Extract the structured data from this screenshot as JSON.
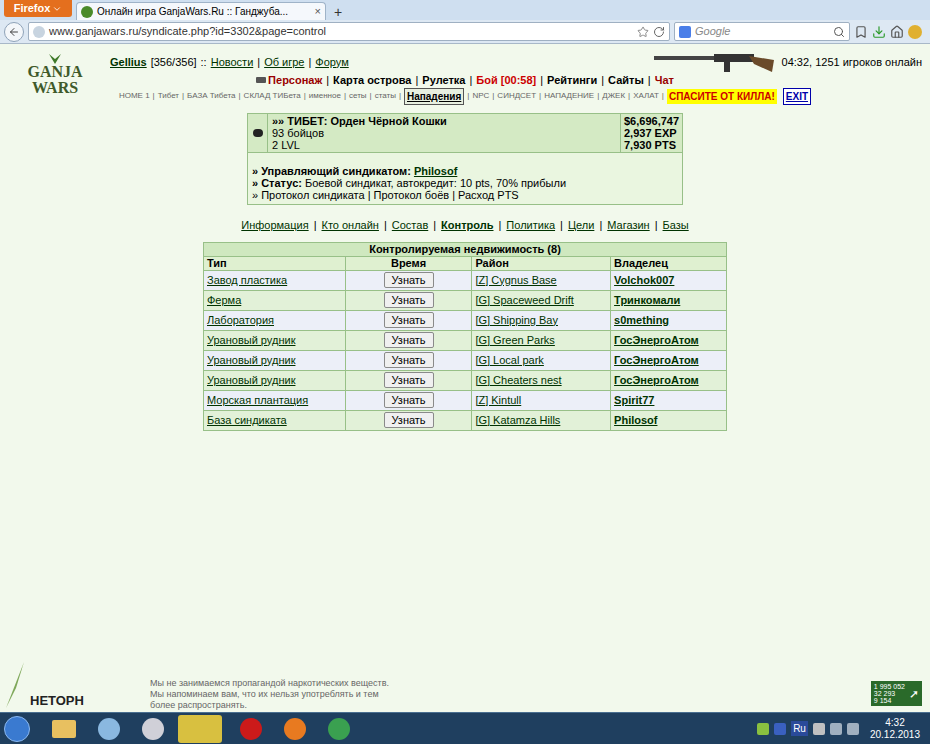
{
  "browser": {
    "menu_button": "Firefox",
    "tab": {
      "title": "Онлайн игра GanjaWars.Ru :: Ганджуба...",
      "close": "×"
    },
    "new_tab": "+",
    "url": "www.ganjawars.ru/syndicate.php?id=3302&page=control",
    "search_placeholder": "Google"
  },
  "header": {
    "logo": [
      "GANJA",
      "WARS"
    ],
    "user": "Gellius",
    "hp": "[356/356]",
    "separator": "::",
    "links": [
      "Новости",
      "Об игре",
      "Форум"
    ],
    "clock": "04:32, 1251 игроков онлайн"
  },
  "separator": "|",
  "main_menu": [
    {
      "label": "Персонаж",
      "color": "#990000"
    },
    {
      "label": "Карта острова",
      "color": "#000000"
    },
    {
      "label": "Рулетка",
      "color": "#000000"
    },
    {
      "label": "Бой [00:58]",
      "color": "#cc0000"
    },
    {
      "label": "Рейтинги",
      "color": "#000000"
    },
    {
      "label": "Сайты",
      "color": "#000000"
    },
    {
      "label": "Чат",
      "color": "#990000"
    }
  ],
  "quick_links": [
    {
      "label": "HOME 1",
      "kind": "link",
      "selected": false
    },
    {
      "label": "Тибет",
      "kind": "link",
      "selected": false
    },
    {
      "label": "БАЗА Тибета",
      "kind": "link",
      "selected": false
    },
    {
      "label": "СКЛАД ТИБета",
      "kind": "link",
      "selected": false
    },
    {
      "label": "именное",
      "kind": "link",
      "selected": false
    },
    {
      "label": "сеты",
      "kind": "link",
      "selected": false
    },
    {
      "label": "статы",
      "kind": "link",
      "selected": false
    },
    {
      "label": "Нападения",
      "kind": "link",
      "selected": true
    },
    {
      "label": "NPC",
      "kind": "link",
      "selected": false
    },
    {
      "label": "СИНДСЕТ",
      "kind": "link",
      "selected": false
    },
    {
      "label": "НАПАДЕНИЕ",
      "kind": "link",
      "selected": false
    },
    {
      "label": "ДЖЕК",
      "kind": "link",
      "selected": false
    },
    {
      "label": "ХАЛАТ",
      "kind": "link",
      "selected": false
    },
    {
      "label": "СПАСИТЕ ОТ КИЛЛА!",
      "kind": "alert",
      "selected": false
    },
    {
      "label": "EXIT",
      "kind": "exit",
      "selected": false
    }
  ],
  "syndicate": {
    "name": "»» ТИБЕТ: Орден Чёрной Кошки",
    "fighters": "93 бойцов",
    "level": "2 LVL",
    "money": "$6,696,747",
    "exp": "2,937 EXP",
    "pts": "7,930 PTS",
    "manager_label": "» Управляющий синдикатом:",
    "manager": "Philosof",
    "status_label": "» Статус:",
    "status": "Боевой синдикат, автокредит: 10 pts, 70% прибыли",
    "protocols_prefix": "»",
    "protocols": [
      "Протокол синдиката",
      "Протокол боёв",
      "Расход PTS"
    ]
  },
  "tabs": [
    {
      "label": "Информация",
      "selected": false
    },
    {
      "label": "Кто онлайн",
      "selected": false
    },
    {
      "label": "Состав",
      "selected": false
    },
    {
      "label": "Контроль",
      "selected": true
    },
    {
      "label": "Политика",
      "selected": false
    },
    {
      "label": "Цели",
      "selected": false
    },
    {
      "label": "Магазин",
      "selected": false
    },
    {
      "label": "Базы",
      "selected": false
    }
  ],
  "table": {
    "title": "Контролируемая недвижимость (8)",
    "columns": [
      "Тип",
      "Время",
      "Район",
      "Владелец"
    ],
    "button": "Узнать",
    "rows": [
      {
        "type": "Завод пластика",
        "district": "[Z] Cygnus Base",
        "owner": "Volchok007"
      },
      {
        "type": "Ферма",
        "district": "[G] Spaceweed Drift",
        "owner": "Тринкомали"
      },
      {
        "type": "Лаборатория",
        "district": "[G] Shipping Bay",
        "owner": "s0mething"
      },
      {
        "type": "Урановый рудник",
        "district": "[G] Green Parks",
        "owner": "ГосЭнергоАтом"
      },
      {
        "type": "Урановый рудник",
        "district": "[G] Local park",
        "owner": "ГосЭнергоАтом"
      },
      {
        "type": "Урановый рудник",
        "district": "[G] Cheaters nest",
        "owner": "ГосЭнергоАтом"
      },
      {
        "type": "Морская плантация",
        "district": "[Z] Kintull",
        "owner": "Spirit77"
      },
      {
        "type": "База синдиката",
        "district": "[G] Katamza Hills",
        "owner": "Philosof"
      }
    ]
  },
  "footer": {
    "logo": "НЕТОРН",
    "disclaimer": [
      "Мы не занимаемся пропагандой наркотических веществ.",
      "Мы напоминаем вам, что их нельзя употреблять и тем",
      "более распространять."
    ],
    "counter": [
      "1 995 052",
      "32 293",
      "9 154"
    ]
  },
  "taskbar": {
    "lang": "Ru",
    "time": "4:32",
    "date": "20.12.2013"
  }
}
